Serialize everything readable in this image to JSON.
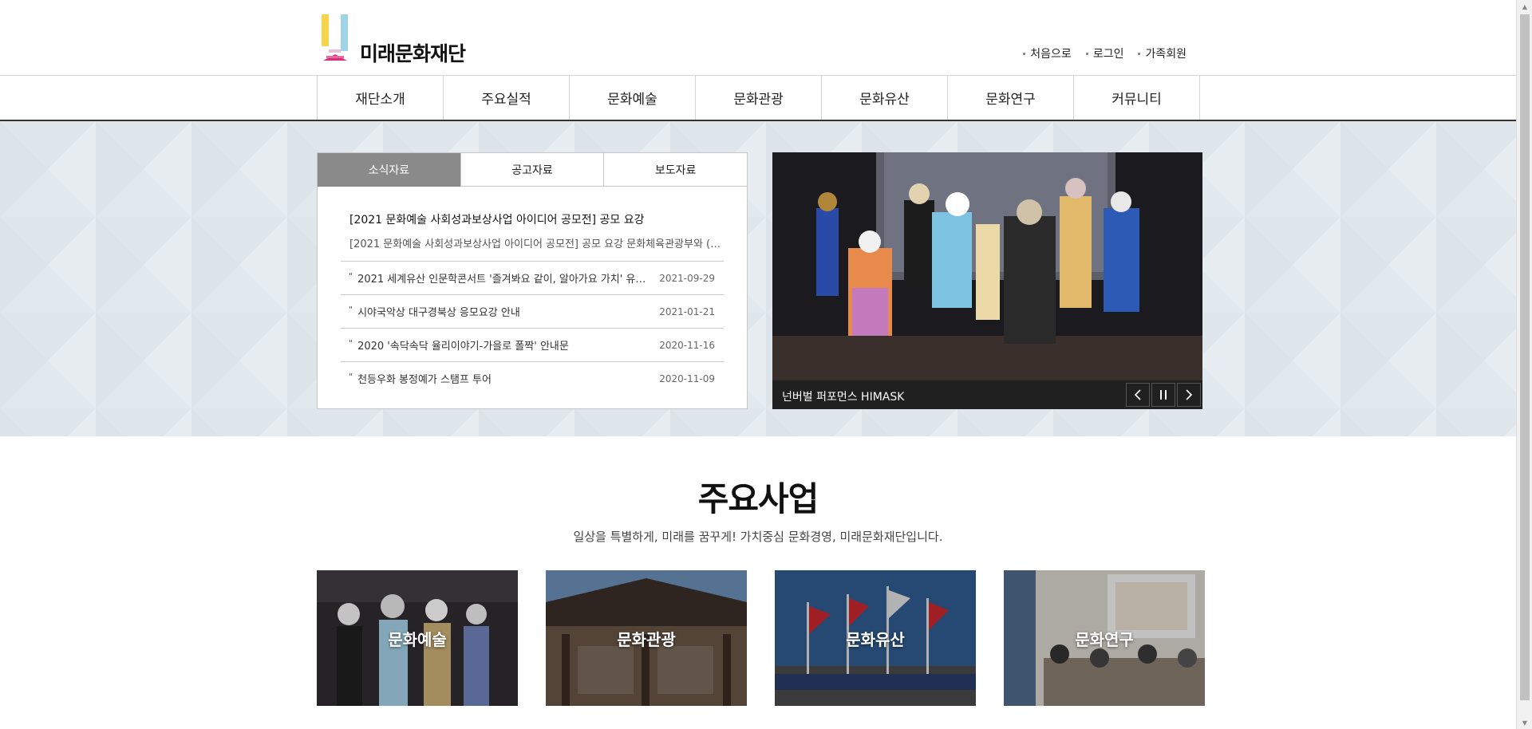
{
  "header": {
    "logo_text": "미래문화재단",
    "util_links": [
      "처음으로",
      "로그인",
      "가족회원"
    ]
  },
  "gnb": {
    "items": [
      "재단소개",
      "주요실적",
      "문화예술",
      "문화관광",
      "문화유산",
      "문화연구",
      "커뮤니티"
    ]
  },
  "news": {
    "tabs": [
      "소식자료",
      "공고자료",
      "보도자료"
    ],
    "active_tab": "소식자료",
    "headline": {
      "title": "[2021 문화예술 사회성과보상사업 아이디어 공모전] 공모 요강",
      "desc": "[2021 문화예술 사회성과보상사업 아이디어 공모전] 공모 요강 문화체육관광부와 (…"
    },
    "items": [
      {
        "title": "2021 세계유산 인문학콘서트 '즐겨봐요 같이, 알아가요 가치' 유…",
        "date": "2021-09-29"
      },
      {
        "title": "시야국악상 대구경북상 응모요강 안내",
        "date": "2021-01-21"
      },
      {
        "title": "2020 '속닥속닥 율리이야기-가을로 폴짝' 안내문",
        "date": "2020-11-16"
      },
      {
        "title": "천등우화 봉정예가 스탬프 투어",
        "date": "2020-11-09"
      }
    ]
  },
  "slider": {
    "caption": "넌버벌 퍼포먼스 HIMASK",
    "prev_icon": "chevron-left-icon",
    "pause_icon": "pause-icon",
    "next_icon": "chevron-right-icon"
  },
  "business": {
    "title": "주요사업",
    "subtitle": "일상을 특별하게, 미래를 꿈꾸게! 가치중심 문화경영, 미래문화재단입니다.",
    "cards": [
      "문화예술",
      "문화관광",
      "문화유산",
      "문화연구"
    ]
  },
  "colors": {
    "band_bg": "#e2e9ee",
    "tab_active": "#8a8a8a",
    "caption_bg": "#202020"
  }
}
